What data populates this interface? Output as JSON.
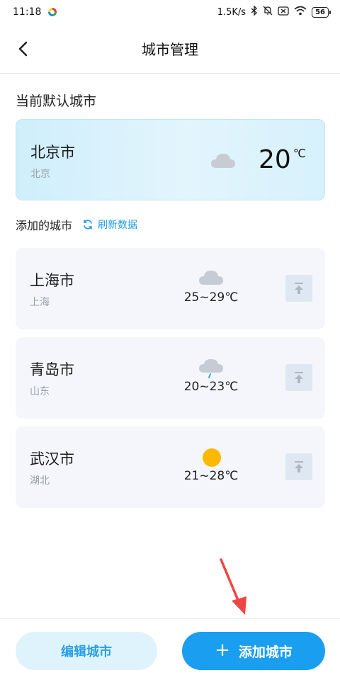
{
  "status_bar": {
    "time": "11:18",
    "net_speed": "1.5K/s",
    "battery": "56",
    "icons": [
      "app-icon",
      "bluetooth-icon",
      "mute-icon",
      "sim-icon",
      "wifi-icon",
      "battery-icon"
    ]
  },
  "header": {
    "title": "城市管理",
    "back_icon": "back-arrow-icon"
  },
  "default_section": {
    "title": "当前默认城市",
    "city": {
      "name": "北京市",
      "province": "北京",
      "weather_icon": "cloudy-icon",
      "temperature": "20",
      "unit": "℃"
    }
  },
  "added_section": {
    "title": "添加的城市",
    "refresh_label": "刷新数据",
    "refresh_icon": "refresh-icon",
    "cities": [
      {
        "name": "上海市",
        "province": "上海",
        "weather_icon": "cloudy-icon",
        "temp_range": "25~29℃"
      },
      {
        "name": "青岛市",
        "province": "山东",
        "weather_icon": "light-rain-icon",
        "temp_range": "20~23℃"
      },
      {
        "name": "武汉市",
        "province": "湖北",
        "weather_icon": "sunny-icon",
        "temp_range": "21~28℃"
      }
    ]
  },
  "bottom": {
    "edit_label": "编辑城市",
    "add_label": "添加城市",
    "add_icon": "plus-icon"
  },
  "colors": {
    "accent": "#1a9ef0",
    "accent_light": "#dff3fc",
    "card_bg": "#f4f6fb",
    "default_card_bg": "#d7f1fc",
    "sun": "#fdb900",
    "annotation_arrow": "#f04545"
  }
}
